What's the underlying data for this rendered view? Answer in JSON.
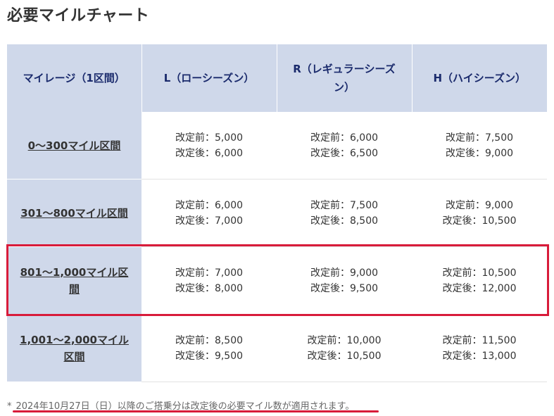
{
  "page": {
    "title": "必要マイルチャート"
  },
  "table": {
    "headers": [
      "マイレージ（1区間）",
      "L（ローシーズン）",
      "R（レギュラーシーズン）",
      "H（ハイシーズン）"
    ],
    "rows": [
      {
        "label": "0〜300マイル区間",
        "cells": [
          [
            "改定前：5,000",
            "改定後：6,000"
          ],
          [
            "改定前：6,000",
            "改定後：6,500"
          ],
          [
            "改定前：7,500",
            "改定後：9,000"
          ]
        ]
      },
      {
        "label": "301〜800マイル区間",
        "cells": [
          [
            "改定前：6,000",
            "改定後：7,000"
          ],
          [
            "改定前：7,500",
            "改定後：8,500"
          ],
          [
            "改定前：9,000",
            "改定後：10,500"
          ]
        ]
      },
      {
        "label": "801〜1,000マイル区間",
        "cells": [
          [
            "改定前：7,000",
            "改定後：8,000"
          ],
          [
            "改定前：9,000",
            "改定後：9,500"
          ],
          [
            "改定前：10,500",
            "改定後：12,000"
          ]
        ]
      },
      {
        "label": "1,001〜2,000マイル区間",
        "cells": [
          [
            "改定前：8,500",
            "改定後：9,500"
          ],
          [
            "改定前：10,000",
            "改定後：10,500"
          ],
          [
            "改定前：11,500",
            "改定後：13,000"
          ]
        ]
      }
    ]
  },
  "footnote": {
    "mark": "*",
    "text": "2024年10月27日（日）以降のご搭乗分は改定後の必要マイル数が適用されます。"
  },
  "colors": {
    "header_bg": "#cfd8ea",
    "header_text": "#1a2a6c",
    "highlight": "#d81b3a"
  }
}
